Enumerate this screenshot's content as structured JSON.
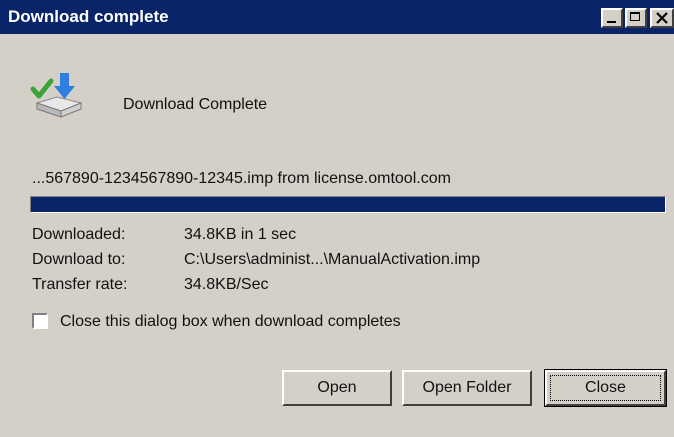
{
  "window": {
    "title": "Download complete"
  },
  "header": {
    "label": "Download Complete",
    "icon": "download-complete-icon"
  },
  "source": {
    "text": "...567890-1234567890-12345.imp from license.omtool.com"
  },
  "progress": {
    "fraction": 1.0,
    "color": "#0a246a"
  },
  "details": [
    {
      "label": "Downloaded:",
      "value": "34.8KB in 1 sec"
    },
    {
      "label": "Download to:",
      "value": "C:\\Users\\administ...\\ManualActivation.imp"
    },
    {
      "label": "Transfer rate:",
      "value": "34.8KB/Sec"
    }
  ],
  "close_on_complete": {
    "label": "Close this dialog box when download completes",
    "checked": false
  },
  "buttons": {
    "open": "Open",
    "open_folder": "Open Folder",
    "close": "Close"
  },
  "colors": {
    "titlebar": "#0a246a",
    "dialog_bg": "#d4d0c8"
  }
}
